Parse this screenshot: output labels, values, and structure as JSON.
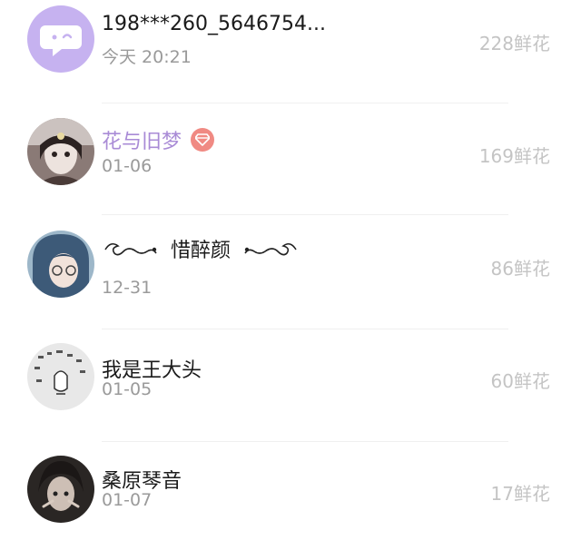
{
  "list": {
    "items": [
      {
        "name": "198***260_5646754...",
        "date": "今天 20:21",
        "flowers": "228鲜花",
        "avatar": "chat-bubble-avatar",
        "name_color": "#1a1a1a"
      },
      {
        "name": "花与旧梦",
        "date": "01-06",
        "flowers": "169鲜花",
        "avatar": "user-avatar-photo",
        "name_color": "#a98bd6",
        "badge": "diamond-icon"
      },
      {
        "name": "惜醉颜",
        "date": "12-31",
        "flowers": "86鲜花",
        "avatar": "user-avatar-photo"
      },
      {
        "name": "我是王大头",
        "date": "01-05",
        "flowers": "60鲜花",
        "avatar": "user-avatar-photo"
      },
      {
        "name": "桑原琴音",
        "date": "01-07",
        "flowers": "17鲜花",
        "avatar": "user-avatar-photo"
      }
    ]
  },
  "colors": {
    "avatar_bubble_bg": "#c6b2f0",
    "vip_purple": "#a98bd6",
    "badge_red": "#f08a83",
    "flowers_gray": "#c4c4c4",
    "date_gray": "#9a9a9a"
  }
}
